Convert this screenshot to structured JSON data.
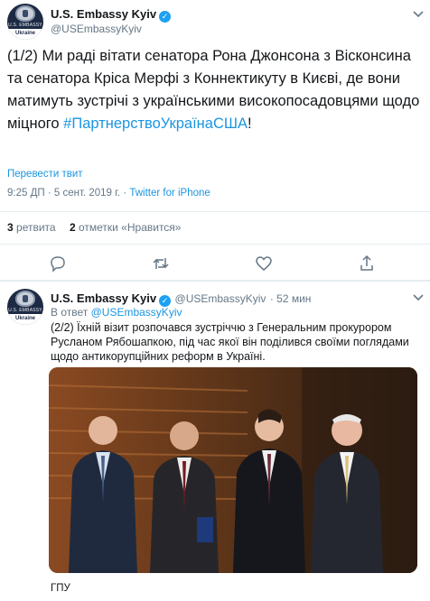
{
  "main_tweet": {
    "author_name": "U.S. Embassy Kyiv",
    "author_handle": "@USEmbassyKyiv",
    "avatar": {
      "top_text": "U.S. EMBASSY",
      "bottom_text": "Ukraine"
    },
    "text_main": "(1/2) Ми раді вітати сенатора Рона Джонсона з Вісконсина та сенатора Кріса Мерфі з Коннектикуту в Києві, де вони матимуть зустрічі з українськими високопосадовцями щодо міцного ",
    "hashtag": "#ПартнерствоУкраїнаСША",
    "text_end": "!",
    "translate_label": "Перевести твит",
    "time": "9:25 ДП · 5 сент. 2019 г. ·",
    "source": "Twitter for iPhone",
    "retweets_count": "3",
    "retweets_label": "ретвита",
    "likes_count": "2",
    "likes_label": "отметки «Нравится»"
  },
  "reply_tweet": {
    "author_name": "U.S. Embassy Kyiv",
    "author_handle": "@USEmbassyKyiv",
    "age": "· 52 мин",
    "avatar": {
      "top_text": "U.S. EMBASSY",
      "bottom_text": "Ukraine"
    },
    "reply_prefix": "В ответ",
    "reply_to": "@USEmbassyKyiv",
    "text": "(2/2) Їхній візит розпочався зустріччю з Генеральним прокурором Русланом Рябошапкою, під час якої він поділився своїми поглядами щодо антикорупційних реформ в Україні.",
    "footer_text": "ГПУ"
  },
  "icons": [
    "verified-badge-icon",
    "chevron-down-icon",
    "reply-icon",
    "retweet-icon",
    "like-icon",
    "share-icon"
  ],
  "colors": {
    "link": "#1b95e0",
    "verified": "#1da1f2",
    "muted": "#657786"
  }
}
